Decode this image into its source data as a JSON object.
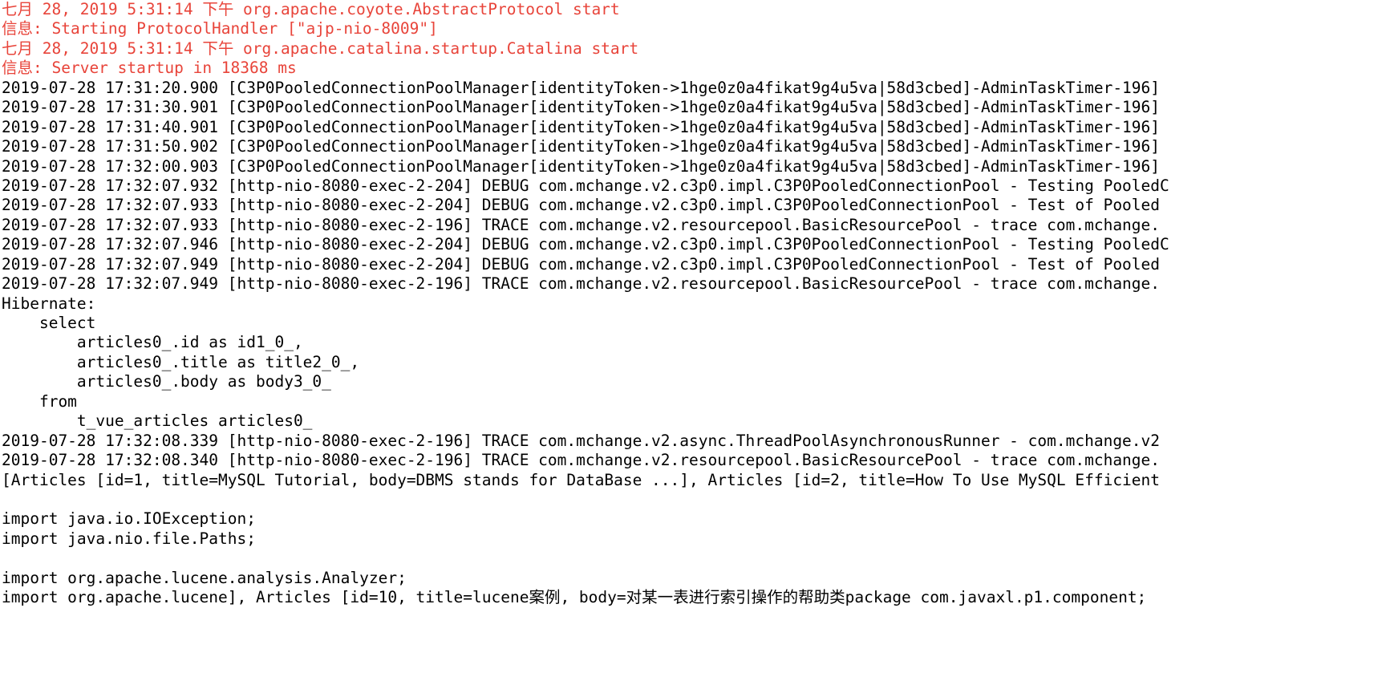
{
  "console": {
    "name": "run-console-output",
    "background_color": "#ffffff",
    "text_color": "#000000",
    "error_color": "#e8443a",
    "lines": [
      {
        "text": "七月 28, 2019 5:31:14 下午 org.apache.coyote.AbstractProtocol start",
        "style": "err"
      },
      {
        "text": "信息: Starting ProtocolHandler [\"ajp-nio-8009\"]",
        "style": "err"
      },
      {
        "text": "七月 28, 2019 5:31:14 下午 org.apache.catalina.startup.Catalina start",
        "style": "err"
      },
      {
        "text": "信息: Server startup in 18368 ms",
        "style": "err"
      },
      {
        "text": "2019-07-28 17:31:20.900 [C3P0PooledConnectionPoolManager[identityToken->1hge0z0a4fikat9g4u5va|58d3cbed]-AdminTaskTimer-196]",
        "style": "out"
      },
      {
        "text": "2019-07-28 17:31:30.901 [C3P0PooledConnectionPoolManager[identityToken->1hge0z0a4fikat9g4u5va|58d3cbed]-AdminTaskTimer-196]",
        "style": "out"
      },
      {
        "text": "2019-07-28 17:31:40.901 [C3P0PooledConnectionPoolManager[identityToken->1hge0z0a4fikat9g4u5va|58d3cbed]-AdminTaskTimer-196]",
        "style": "out"
      },
      {
        "text": "2019-07-28 17:31:50.902 [C3P0PooledConnectionPoolManager[identityToken->1hge0z0a4fikat9g4u5va|58d3cbed]-AdminTaskTimer-196]",
        "style": "out"
      },
      {
        "text": "2019-07-28 17:32:00.903 [C3P0PooledConnectionPoolManager[identityToken->1hge0z0a4fikat9g4u5va|58d3cbed]-AdminTaskTimer-196]",
        "style": "out"
      },
      {
        "text": "2019-07-28 17:32:07.932 [http-nio-8080-exec-2-204] DEBUG com.mchange.v2.c3p0.impl.C3P0PooledConnectionPool - Testing PooledC",
        "style": "out"
      },
      {
        "text": "2019-07-28 17:32:07.933 [http-nio-8080-exec-2-204] DEBUG com.mchange.v2.c3p0.impl.C3P0PooledConnectionPool - Test of Pooled",
        "style": "out"
      },
      {
        "text": "2019-07-28 17:32:07.933 [http-nio-8080-exec-2-196] TRACE com.mchange.v2.resourcepool.BasicResourcePool - trace com.mchange.",
        "style": "out"
      },
      {
        "text": "2019-07-28 17:32:07.946 [http-nio-8080-exec-2-204] DEBUG com.mchange.v2.c3p0.impl.C3P0PooledConnectionPool - Testing PooledC",
        "style": "out"
      },
      {
        "text": "2019-07-28 17:32:07.949 [http-nio-8080-exec-2-204] DEBUG com.mchange.v2.c3p0.impl.C3P0PooledConnectionPool - Test of Pooled",
        "style": "out"
      },
      {
        "text": "2019-07-28 17:32:07.949 [http-nio-8080-exec-2-196] TRACE com.mchange.v2.resourcepool.BasicResourcePool - trace com.mchange.",
        "style": "out"
      },
      {
        "text": "Hibernate: ",
        "style": "out"
      },
      {
        "text": "    select",
        "style": "out"
      },
      {
        "text": "        articles0_.id as id1_0_,",
        "style": "out"
      },
      {
        "text": "        articles0_.title as title2_0_,",
        "style": "out"
      },
      {
        "text": "        articles0_.body as body3_0_",
        "style": "out"
      },
      {
        "text": "    from",
        "style": "out"
      },
      {
        "text": "        t_vue_articles articles0_",
        "style": "out"
      },
      {
        "text": "2019-07-28 17:32:08.339 [http-nio-8080-exec-2-196] TRACE com.mchange.v2.async.ThreadPoolAsynchronousRunner - com.mchange.v2",
        "style": "out"
      },
      {
        "text": "2019-07-28 17:32:08.340 [http-nio-8080-exec-2-196] TRACE com.mchange.v2.resourcepool.BasicResourcePool - trace com.mchange.",
        "style": "out"
      },
      {
        "text": "[Articles [id=1, title=MySQL Tutorial, body=DBMS stands for DataBase ...], Articles [id=2, title=How To Use MySQL Efficient",
        "style": "out"
      },
      {
        "text": "",
        "style": "blank"
      },
      {
        "text": "import java.io.IOException;",
        "style": "out"
      },
      {
        "text": "import java.nio.file.Paths;",
        "style": "out"
      },
      {
        "text": "",
        "style": "blank"
      },
      {
        "text": "import org.apache.lucene.analysis.Analyzer;",
        "style": "out"
      },
      {
        "text": "import org.apache.lucene], Articles [id=10, title=lucene案例, body=对某一表进行索引操作的帮助类package com.javaxl.p1.component;",
        "style": "out"
      }
    ]
  }
}
